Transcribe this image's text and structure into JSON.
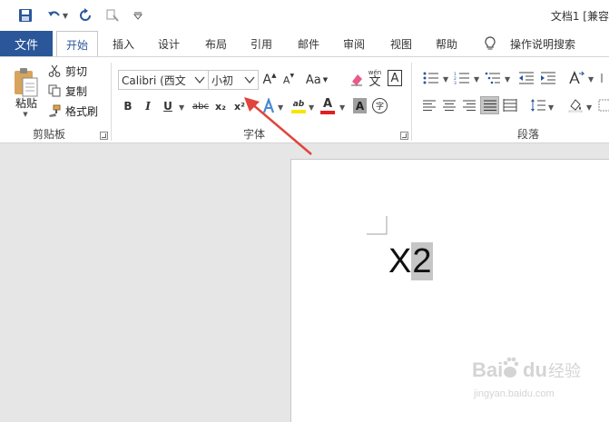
{
  "window": {
    "title": "文档1 [兼容"
  },
  "tabs": {
    "file": "文件",
    "items": [
      "开始",
      "插入",
      "设计",
      "布局",
      "引用",
      "邮件",
      "审阅",
      "视图",
      "帮助"
    ],
    "tell_me": "操作说明搜索"
  },
  "clipboard": {
    "paste": "粘贴",
    "cut": "剪切",
    "copy": "复制",
    "format_painter": "格式刷",
    "group_label": "剪贴板"
  },
  "font": {
    "font_name": "Calibri (西文",
    "font_size": "小初",
    "group_label": "字体",
    "bold": "B",
    "italic": "I",
    "underline": "U",
    "strike": "abc",
    "subscript": "x₂",
    "superscript": "x²",
    "grow": "A",
    "shrink": "A",
    "case": "Aa",
    "phonetic": "wén",
    "phonetic_char": "文",
    "border_char": "A",
    "enclose_char": "字",
    "highlight": "ab",
    "font_color": "A",
    "shading": "A"
  },
  "paragraph": {
    "group_label": "段落"
  },
  "document": {
    "text_main": "X",
    "text_selected": "2"
  },
  "watermark": {
    "brand": "Bai",
    "brand2": "du",
    "cn": "经验",
    "url": "jingyan.baidu.com"
  },
  "colors": {
    "accent": "#2b579a",
    "arrow": "#e0443c",
    "highlight": "#f5e600",
    "font_red": "#e02020",
    "selection": "#c6c6c6"
  }
}
